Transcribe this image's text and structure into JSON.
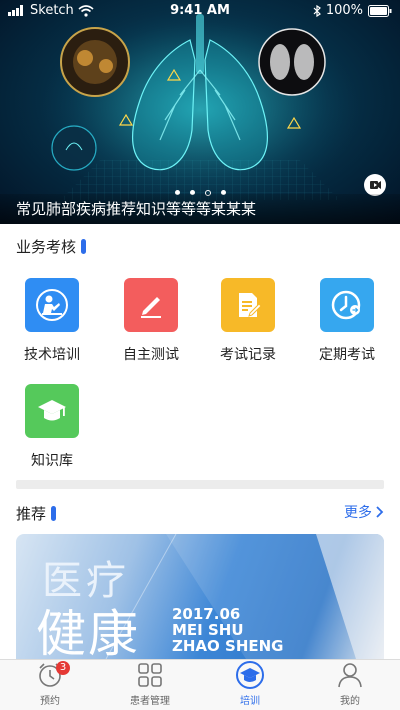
{
  "status_bar": {
    "carrier": "Sketch",
    "time": "9:41 AM",
    "battery": "100%"
  },
  "banner": {
    "caption": "常见肺部疾病推荐知识等等等某某某",
    "page_count": 4,
    "active_page": 3
  },
  "assessment": {
    "title": "业务考核",
    "items": [
      {
        "label": "技术培训",
        "icon": "presenter-icon",
        "color": "#2f8df3"
      },
      {
        "label": "自主测试",
        "icon": "pen-icon",
        "color": "#f35d5d"
      },
      {
        "label": "考试记录",
        "icon": "document-pen-icon",
        "color": "#f7b928"
      },
      {
        "label": "定期考试",
        "icon": "clock-icon",
        "color": "#36a7ef"
      },
      {
        "label": "知识库",
        "icon": "graduation-cap-icon",
        "color": "#55c95b"
      }
    ]
  },
  "recommend": {
    "title": "推荐",
    "more_label": "更多",
    "card": {
      "line1": "医疗",
      "line2": "健康",
      "date": "2017.06",
      "name1": "MEI SHU",
      "name2": "ZHAO SHENG"
    }
  },
  "tabbar": {
    "items": [
      {
        "label": "预约",
        "icon": "alarm-clock-icon",
        "badge": "3"
      },
      {
        "label": "患者管理",
        "icon": "grid-icon"
      },
      {
        "label": "培训",
        "icon": "training-icon",
        "active": true
      },
      {
        "label": "我的",
        "icon": "person-icon"
      }
    ]
  },
  "colors": {
    "accent": "#2d6dea",
    "badge": "#e53935"
  }
}
